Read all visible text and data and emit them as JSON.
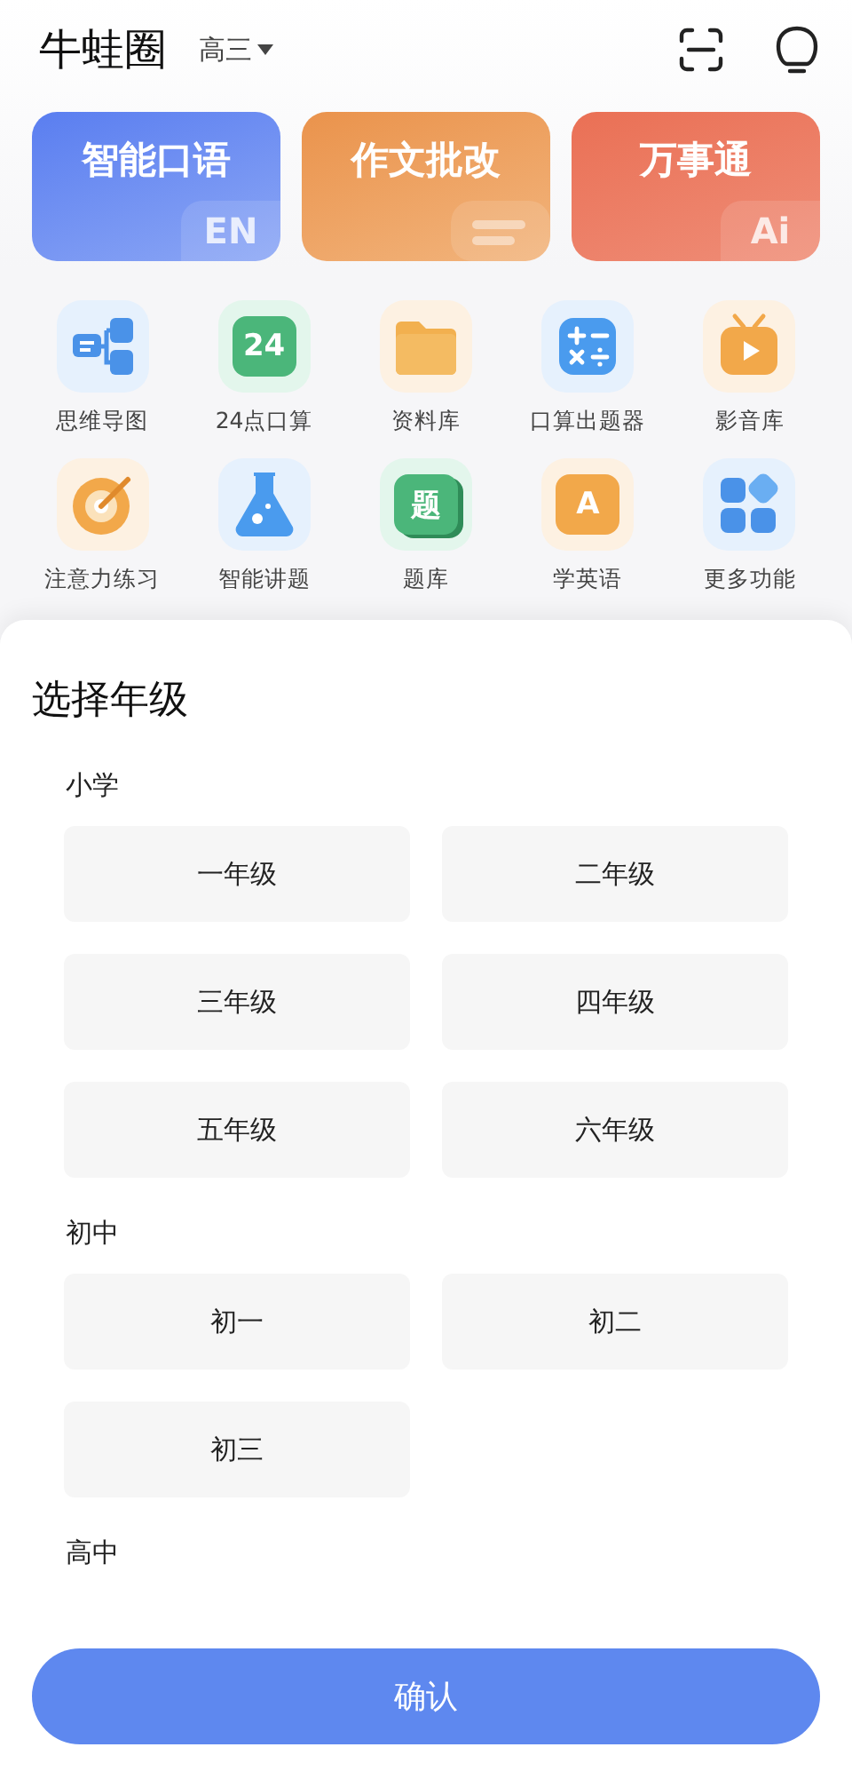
{
  "header": {
    "title": "牛蛙圈",
    "grade": "高三"
  },
  "feature_cards": [
    {
      "label": "智能口语",
      "kind": "blue",
      "badge": "EN"
    },
    {
      "label": "作文批改",
      "kind": "orange"
    },
    {
      "label": "万事通",
      "kind": "red",
      "badge": "Ai"
    }
  ],
  "tools": [
    {
      "label": "思维导图",
      "kind": "mindmap"
    },
    {
      "label": "24点口算",
      "kind": "calc24",
      "icon_text": "24"
    },
    {
      "label": "资料库",
      "kind": "folder"
    },
    {
      "label": "口算出题器",
      "kind": "arith"
    },
    {
      "label": "影音库",
      "kind": "tv"
    },
    {
      "label": "注意力练习",
      "kind": "target"
    },
    {
      "label": "智能讲题",
      "kind": "flask"
    },
    {
      "label": "题库",
      "kind": "book",
      "icon_text": "题"
    },
    {
      "label": "学英语",
      "kind": "english",
      "icon_text": "A"
    },
    {
      "label": "更多功能",
      "kind": "more"
    }
  ],
  "sheet": {
    "title": "选择年级",
    "sections": [
      {
        "name": "小学",
        "grades": [
          {
            "label": "一年级",
            "selected": false
          },
          {
            "label": "二年级",
            "selected": false
          },
          {
            "label": "三年级",
            "selected": false
          },
          {
            "label": "四年级",
            "selected": false
          },
          {
            "label": "五年级",
            "selected": false
          },
          {
            "label": "六年级",
            "selected": false
          }
        ]
      },
      {
        "name": "初中",
        "grades": [
          {
            "label": "初一",
            "selected": false
          },
          {
            "label": "初二",
            "selected": false
          },
          {
            "label": "初三",
            "selected": false
          }
        ]
      },
      {
        "name": "高中"
      }
    ],
    "confirm": "确认"
  }
}
